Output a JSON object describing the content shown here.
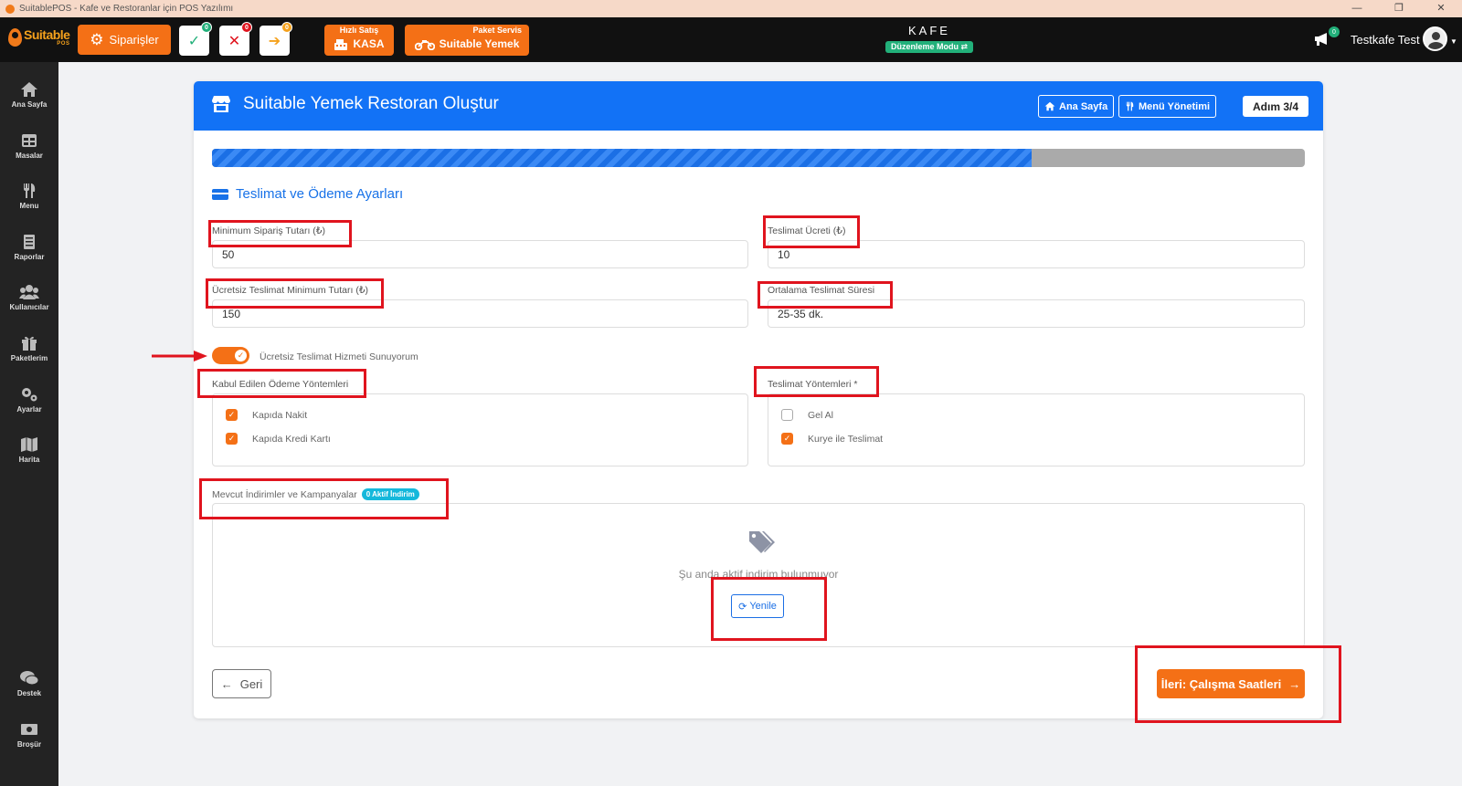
{
  "window": {
    "title": "SuitablePOS - Kafe ve Restoranlar için POS Yazılımı",
    "minimize": "—",
    "restore": "❐",
    "close": "✕"
  },
  "topbar": {
    "logo_text": "Suitable",
    "logo_sub": "POS",
    "orders_label": "Siparişler",
    "status_buttons": [
      {
        "symbol": "✓",
        "count": "0",
        "color": "#22b07a"
      },
      {
        "symbol": "✕",
        "count": "0",
        "color": "#e0141e"
      },
      {
        "symbol": "➔",
        "count": "0",
        "color": "#f5a11c"
      }
    ],
    "kasa": {
      "caption": "Hızlı Satış",
      "label": "KASA"
    },
    "delivery": {
      "caption": "Paket Servis",
      "label": "Suitable Yemek"
    },
    "mode_title": "KAFE",
    "mode_pill": "Düzenleme Modu ⇄",
    "announcement_count": "0",
    "user_name": "Testkafe Test"
  },
  "sidebar": {
    "items": [
      {
        "label": "Ana Sayfa",
        "icon": "home-icon"
      },
      {
        "label": "Masalar",
        "icon": "table-icon"
      },
      {
        "label": "Menu",
        "icon": "fork-knife-icon"
      },
      {
        "label": "Raporlar",
        "icon": "report-icon"
      },
      {
        "label": "Kullanıcılar",
        "icon": "users-icon"
      },
      {
        "label": "Paketlerim",
        "icon": "gift-icon"
      },
      {
        "label": "Ayarlar",
        "icon": "gears-icon"
      },
      {
        "label": "Harita",
        "icon": "map-icon"
      },
      {
        "label": "Destek",
        "icon": "chat-icon"
      },
      {
        "label": "Broşür",
        "icon": "brochure-icon"
      }
    ]
  },
  "page": {
    "title": "Suitable Yemek Restoran Oluştur",
    "home_button": "Ana Sayfa",
    "menu_button": "Menü Yönetimi",
    "step": "Adım 3/4",
    "progress": 0.75,
    "section_title": "Teslimat ve Ödeme Ayarları",
    "fields": {
      "min_order_label": "Minimum Sipariş Tutarı (₺)",
      "min_order_value": "50",
      "delivery_fee_label": "Teslimat Ücreti (₺)",
      "delivery_fee_value": "10",
      "free_min_label": "Ücretsiz Teslimat Minimum Tutarı (₺)",
      "free_min_value": "150",
      "avg_time_label": "Ortalama Teslimat Süresi",
      "avg_time_value": "25-35 dk."
    },
    "free_delivery_toggle": {
      "label": "Ücretsiz Teslimat Hizmeti Sunuyorum",
      "on": true
    },
    "payment_methods": {
      "label": "Kabul Edilen Ödeme Yöntemleri",
      "options": [
        {
          "label": "Kapıda Nakit",
          "checked": true
        },
        {
          "label": "Kapıda Kredi Kartı",
          "checked": true
        }
      ]
    },
    "delivery_methods": {
      "label": "Teslimat Yöntemleri *",
      "options": [
        {
          "label": "Gel Al",
          "checked": false
        },
        {
          "label": "Kurye ile Teslimat",
          "checked": true
        }
      ]
    },
    "discounts": {
      "label": "Mevcut İndirimler ve Kampanyalar",
      "badge": "0 Aktif İndirim",
      "empty_text": "Şu anda aktif indirim bulunmuyor",
      "refresh_label": "Yenile"
    },
    "back_label": "Geri",
    "next_label": "İleri: Çalışma Saatleri"
  },
  "colors": {
    "accent": "#f47016",
    "primary": "#1272f6",
    "annotation": "#e0141e",
    "success": "#22b07a"
  }
}
